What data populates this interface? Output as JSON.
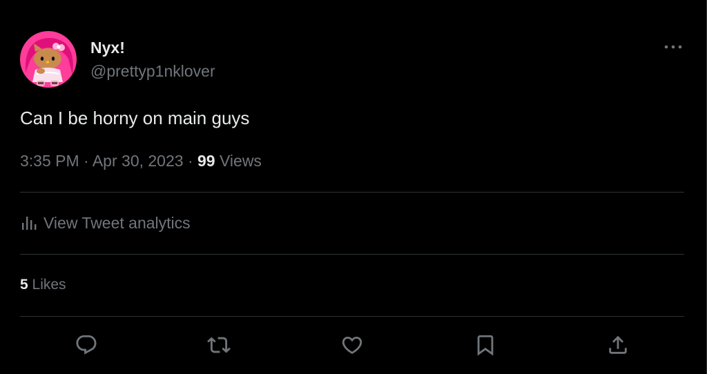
{
  "user": {
    "display_name": "Nyx!",
    "handle": "@prettyp1nklover",
    "avatar_icon": "hello-kitty-avatar"
  },
  "tweet": {
    "text": "Can I be horny on main guys",
    "time": "3:35 PM",
    "separator": "·",
    "date": "Apr 30, 2023",
    "views_count": "99",
    "views_label": "Views"
  },
  "analytics": {
    "label": "View Tweet analytics",
    "icon": "analytics-bar-icon"
  },
  "likes": {
    "count": "5",
    "label": "Likes"
  },
  "actions": {
    "icons": [
      "reply-icon",
      "retweet-icon",
      "like-icon",
      "bookmark-icon",
      "share-icon"
    ]
  },
  "colors": {
    "background": "#000000",
    "primary_text": "#e7e9ea",
    "secondary_text": "#71767b",
    "divider": "#2f3336",
    "avatar_pink": "#ff3d9a"
  }
}
